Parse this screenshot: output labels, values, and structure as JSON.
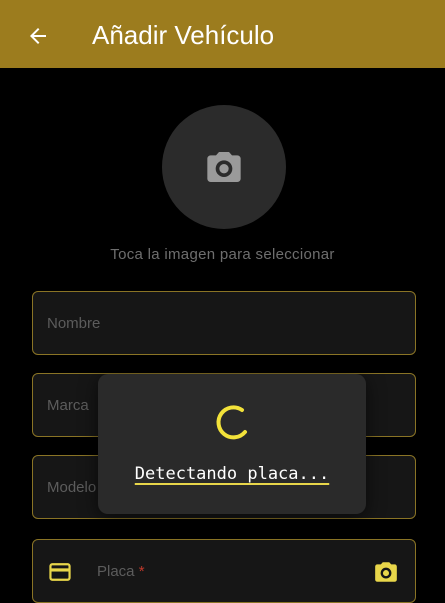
{
  "appbar": {
    "title": "Añadir Vehículo",
    "back_icon": "arrow-left-icon",
    "color": "#9c7c1e"
  },
  "photo": {
    "icon": "camera-icon",
    "hint": "Toca la imagen para seleccionar"
  },
  "form": {
    "nombre_label": "Nombre",
    "marca_label": "Marca",
    "modelo_label": "Modelo",
    "placa_label": "Placa",
    "placa_required": "*",
    "placa_icon": "credit-card-icon",
    "placa_scan_icon": "camera-icon",
    "border_color": "#8a7425"
  },
  "dialog": {
    "message": "Detectando placa...",
    "spinner_color": "#f2e23a"
  }
}
